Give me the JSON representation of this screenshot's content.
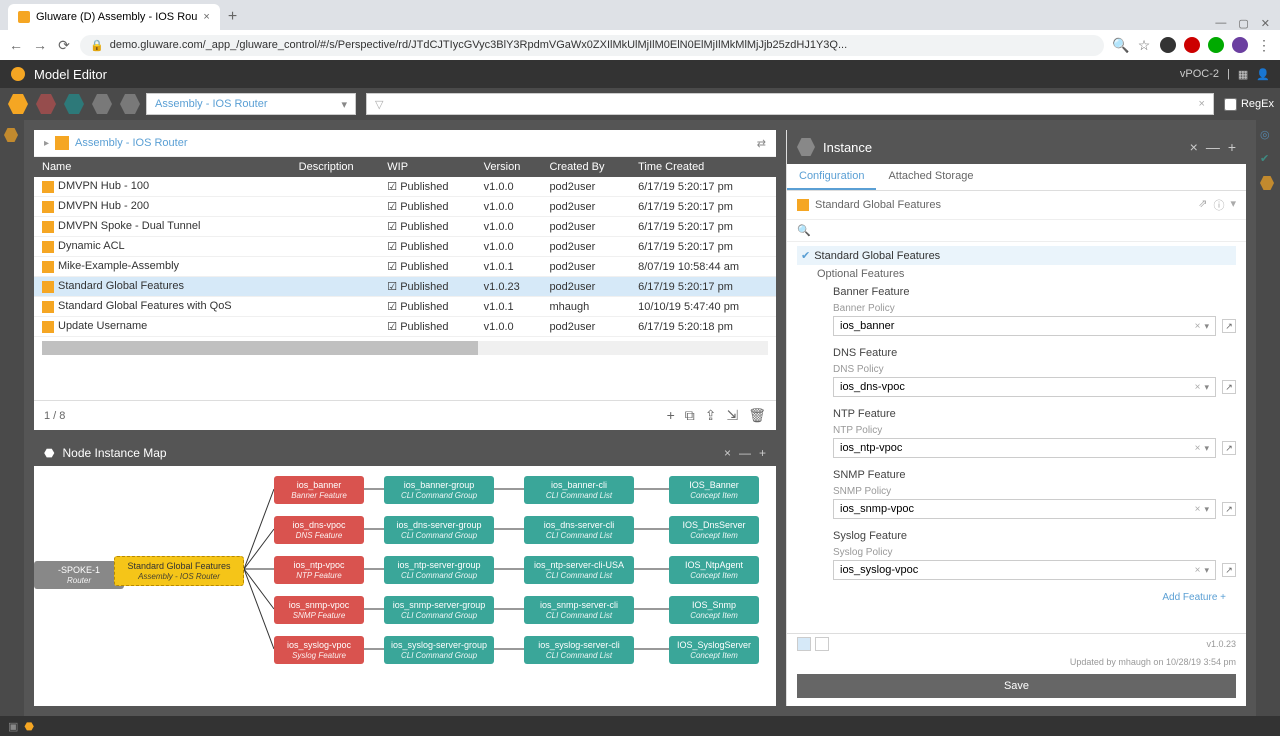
{
  "browser": {
    "tab_title": "Gluware (D) Assembly - IOS Rou",
    "url": "demo.gluware.com/_app_/gluware_control/#/s/Perspective/rd/JTdCJTIycGVyc3BlY3RpdmVGaWx0ZXIlMkUlMjIlM0ElN0ElMjIlMkMlMjJjb25zdHJ1Y3Q...",
    "win_min": "—",
    "win_max": "▢",
    "win_close": "✕"
  },
  "header": {
    "title": "Model Editor",
    "context": "vPOC-2"
  },
  "toolbar": {
    "combo_value": "Assembly - IOS Router",
    "filter_placeholder": "",
    "regex_label": "RegEx"
  },
  "breadcrumb": {
    "item": "Assembly - IOS Router"
  },
  "table": {
    "headers": [
      "Name",
      "Description",
      "WIP",
      "Version",
      "Created By",
      "Time Created"
    ],
    "rows": [
      {
        "name": "DMVPN Hub - 100",
        "desc": "",
        "wip": true,
        "status": "Published",
        "version": "v1.0.0",
        "by": "pod2user",
        "time": "6/17/19 5:20:17 pm"
      },
      {
        "name": "DMVPN Hub - 200",
        "desc": "",
        "wip": true,
        "status": "Published",
        "version": "v1.0.0",
        "by": "pod2user",
        "time": "6/17/19 5:20:17 pm"
      },
      {
        "name": "DMVPN Spoke - Dual Tunnel",
        "desc": "",
        "wip": true,
        "status": "Published",
        "version": "v1.0.0",
        "by": "pod2user",
        "time": "6/17/19 5:20:17 pm"
      },
      {
        "name": "Dynamic ACL",
        "desc": "",
        "wip": true,
        "status": "Published",
        "version": "v1.0.0",
        "by": "pod2user",
        "time": "6/17/19 5:20:17 pm"
      },
      {
        "name": "Mike-Example-Assembly",
        "desc": "",
        "wip": true,
        "status": "Published",
        "version": "v1.0.1",
        "by": "pod2user",
        "time": "8/07/19 10:58:44 am"
      },
      {
        "name": "Standard Global Features",
        "desc": "",
        "wip": true,
        "status": "Published",
        "version": "v1.0.23",
        "by": "pod2user",
        "time": "6/17/19 5:20:17 pm",
        "selected": true
      },
      {
        "name": "Standard Global Features with QoS",
        "desc": "",
        "wip": true,
        "status": "Published",
        "version": "v1.0.1",
        "by": "mhaugh",
        "time": "10/10/19 5:47:40 pm"
      },
      {
        "name": "Update Username",
        "desc": "",
        "wip": true,
        "status": "Published",
        "version": "v1.0.0",
        "by": "pod2user",
        "time": "6/17/19 5:20:18 pm"
      }
    ],
    "pager": "1 / 8"
  },
  "map": {
    "title": "Node Instance Map",
    "nodes": {
      "root_gray": {
        "title": "-SPOKE-1",
        "sub": "Router"
      },
      "root": {
        "title": "Standard Global Features",
        "sub": "Assembly - IOS Router"
      },
      "r1": [
        {
          "title": "ios_banner",
          "sub": "Banner Feature"
        },
        {
          "title": "ios_dns-vpoc",
          "sub": "DNS Feature"
        },
        {
          "title": "ios_ntp-vpoc",
          "sub": "NTP Feature"
        },
        {
          "title": "ios_snmp-vpoc",
          "sub": "SNMP Feature"
        },
        {
          "title": "ios_syslog-vpoc",
          "sub": "Syslog Feature"
        }
      ],
      "g1": [
        {
          "title": "ios_banner-group",
          "sub": "CLI Command Group"
        },
        {
          "title": "ios_dns-server-group",
          "sub": "CLI Command Group"
        },
        {
          "title": "ios_ntp-server-group",
          "sub": "CLI Command Group"
        },
        {
          "title": "ios_snmp-server-group",
          "sub": "CLI Command Group"
        },
        {
          "title": "ios_syslog-server-group",
          "sub": "CLI Command Group"
        }
      ],
      "c1": [
        {
          "title": "ios_banner-cli",
          "sub": "CLI Command List"
        },
        {
          "title": "ios_dns-server-cli",
          "sub": "CLI Command List"
        },
        {
          "title": "ios_ntp-server-cli-USA",
          "sub": "CLI Command List"
        },
        {
          "title": "ios_snmp-server-cli",
          "sub": "CLI Command List"
        },
        {
          "title": "ios_syslog-server-cli",
          "sub": "CLI Command List"
        }
      ],
      "ci": [
        {
          "title": "IOS_Banner",
          "sub": "Concept Item"
        },
        {
          "title": "IOS_DnsServer",
          "sub": "Concept Item"
        },
        {
          "title": "IOS_NtpAgent",
          "sub": "Concept Item"
        },
        {
          "title": "IOS_Snmp",
          "sub": "Concept Item"
        },
        {
          "title": "IOS_SyslogServer",
          "sub": "Concept Item"
        }
      ]
    }
  },
  "instance": {
    "title": "Instance",
    "tabs": {
      "config": "Configuration",
      "storage": "Attached Storage"
    },
    "crumb": "Standard Global Features",
    "search_placeholder": "",
    "tree": {
      "root": "Standard Global Features",
      "optional": "Optional Features",
      "features": [
        {
          "name": "Banner Feature",
          "policy_label": "Banner Policy",
          "value": "ios_banner"
        },
        {
          "name": "DNS Feature",
          "policy_label": "DNS Policy",
          "value": "ios_dns-vpoc"
        },
        {
          "name": "NTP Feature",
          "policy_label": "NTP Policy",
          "value": "ios_ntp-vpoc"
        },
        {
          "name": "SNMP Feature",
          "policy_label": "SNMP Policy",
          "value": "ios_snmp-vpoc"
        },
        {
          "name": "Syslog Feature",
          "policy_label": "Syslog Policy",
          "value": "ios_syslog-vpoc"
        }
      ]
    },
    "add_feature": "Add Feature +",
    "version_info": "v1.0.23",
    "updated_info": "Updated by mhaugh on 10/28/19 3:54 pm",
    "save": "Save"
  }
}
